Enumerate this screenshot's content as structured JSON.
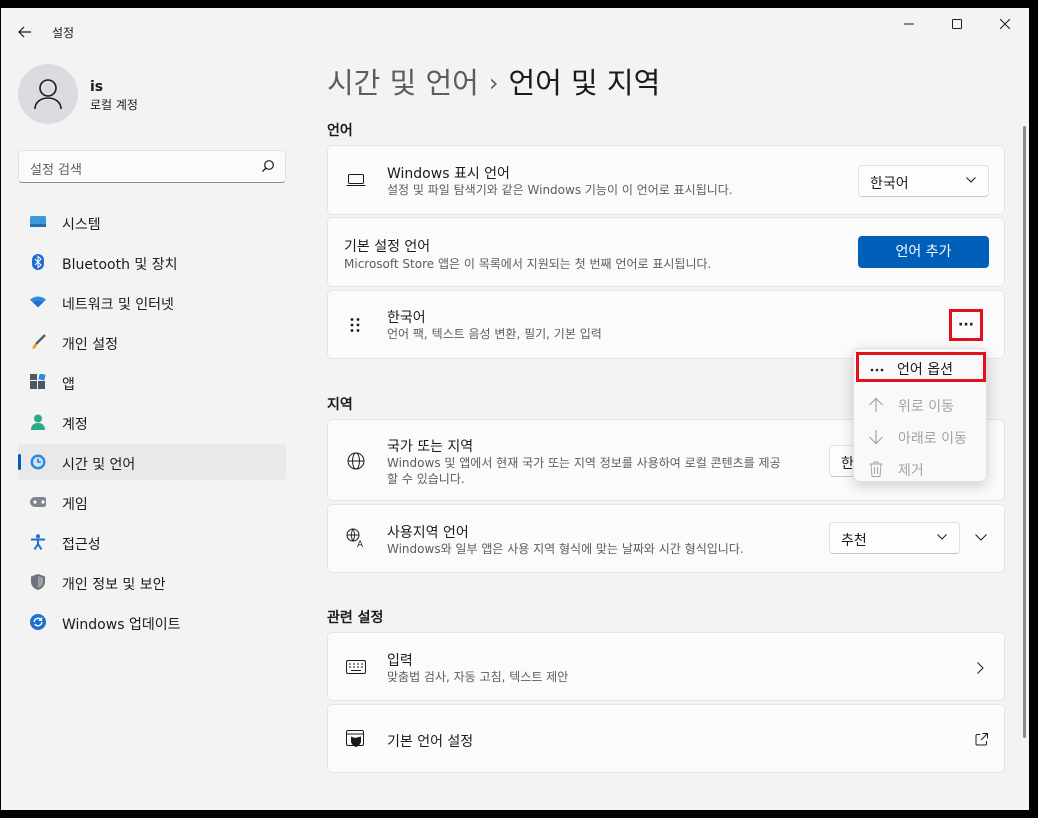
{
  "app": {
    "title": "설정"
  },
  "window_controls": {
    "minimize": "─",
    "maximize": "☐",
    "close": "✕"
  },
  "profile": {
    "name": "is",
    "account_type": "로컬 계정"
  },
  "search": {
    "placeholder": "설정 검색"
  },
  "sidebar": {
    "items": [
      {
        "label": "시스템",
        "icon": "system-icon",
        "active": false
      },
      {
        "label": "Bluetooth 및 장치",
        "icon": "bluetooth-icon",
        "active": false
      },
      {
        "label": "네트워크 및 인터넷",
        "icon": "network-icon",
        "active": false
      },
      {
        "label": "개인 설정",
        "icon": "brush-icon",
        "active": false
      },
      {
        "label": "앱",
        "icon": "apps-icon",
        "active": false
      },
      {
        "label": "계정",
        "icon": "account-icon",
        "active": false
      },
      {
        "label": "시간 및 언어",
        "icon": "time-language-icon",
        "active": true
      },
      {
        "label": "게임",
        "icon": "gaming-icon",
        "active": false
      },
      {
        "label": "접근성",
        "icon": "accessibility-icon",
        "active": false
      },
      {
        "label": "개인 정보 및 보안",
        "icon": "shield-icon",
        "active": false
      },
      {
        "label": "Windows 업데이트",
        "icon": "update-icon",
        "active": false
      }
    ]
  },
  "breadcrumb": {
    "parent": "시간 및 언어",
    "separator": "›",
    "current": "언어 및 지역"
  },
  "sections": {
    "language": "언어",
    "region": "지역",
    "related": "관련 설정"
  },
  "cards": {
    "display_language": {
      "title": "Windows 표시 언어",
      "desc": "설정 및 파일 탐색기와 같은 Windows 기능이 이 언어로 표시됩니다.",
      "value": "한국어"
    },
    "preferred_language": {
      "title": "기본 설정 언어",
      "desc": "Microsoft Store 앱은 이 목록에서 지원되는 첫 번째 언어로 표시됩니다.",
      "button": "언어 추가"
    },
    "korean": {
      "title": "한국어",
      "desc": "언어 팩, 텍스트 음성 변환, 필기, 기본 입력",
      "more": "···"
    },
    "country": {
      "title": "국가 또는 지역",
      "desc_line1": "Windows 및 앱에서 현재 국가 또는 지역 정보를 사용하여 로컬 콘텐츠를 제공",
      "desc_line2": "할 수 있습니다.",
      "value": "한"
    },
    "regional_format": {
      "title": "사용지역 언어",
      "desc": "Windows와 일부 앱은 사용 지역 형식에 맞는 날짜와 시간 형식입니다.",
      "value": "추천"
    },
    "typing": {
      "title": "입력",
      "desc": "맞춤법 검사, 자동 고침, 텍스트 제안"
    },
    "admin_language": {
      "title": "기본 언어 설정"
    }
  },
  "context_menu": {
    "items": [
      {
        "label": "언어 옵션",
        "icon": "more-icon",
        "disabled": false
      },
      {
        "label": "위로 이동",
        "icon": "arrow-up-icon",
        "disabled": true
      },
      {
        "label": "아래로 이동",
        "icon": "arrow-down-icon",
        "disabled": true
      },
      {
        "label": "제거",
        "icon": "trash-icon",
        "disabled": true
      }
    ]
  },
  "colors": {
    "accent": "#005fb8",
    "highlight_box": "#e0111d"
  }
}
